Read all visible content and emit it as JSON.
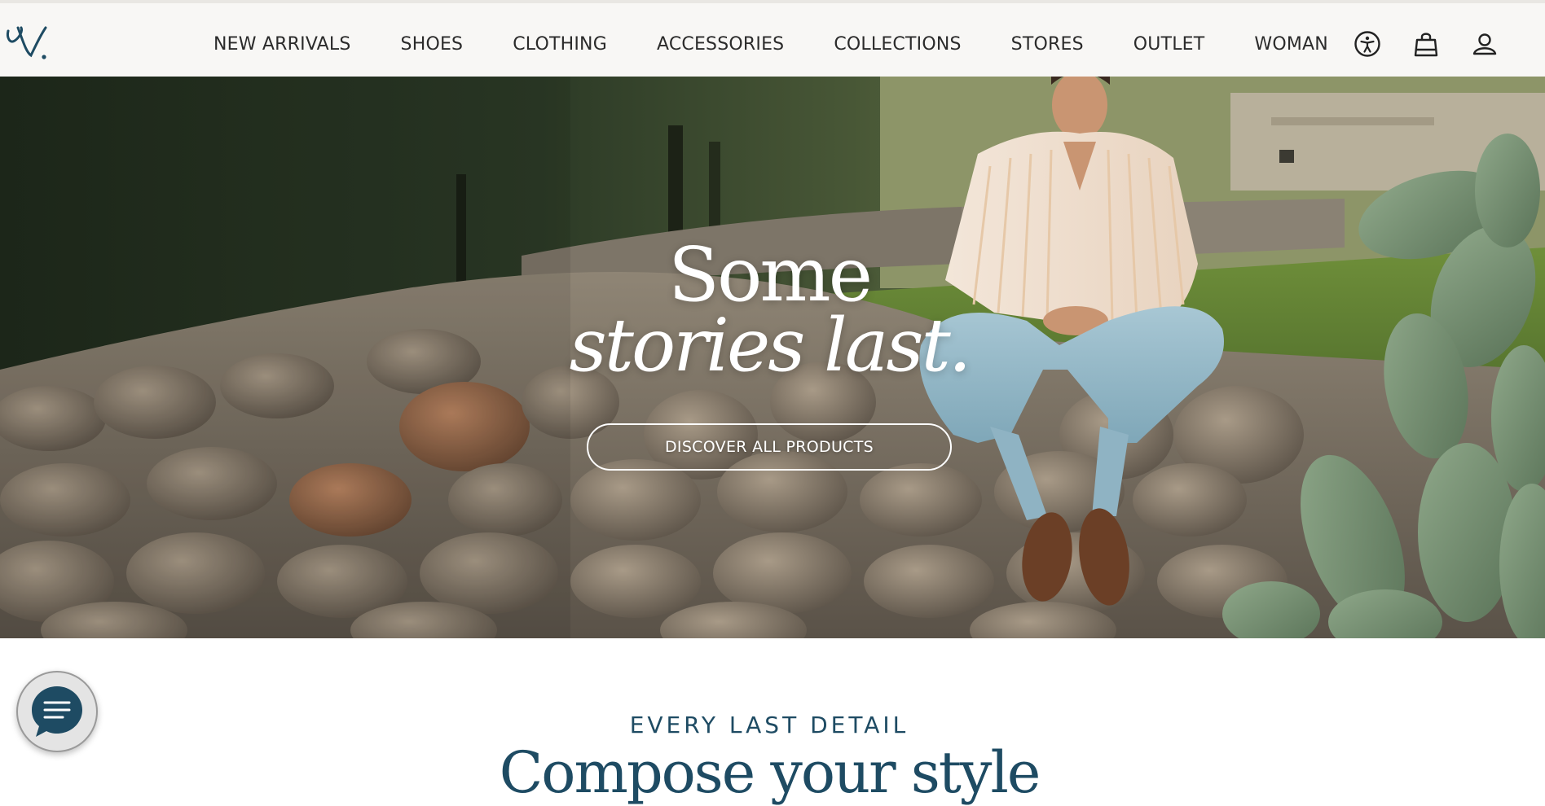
{
  "header": {
    "logo_text": "V.",
    "nav": [
      {
        "label": "NEW ARRIVALS"
      },
      {
        "label": "SHOES"
      },
      {
        "label": "CLOTHING"
      },
      {
        "label": "ACCESSORIES"
      },
      {
        "label": "COLLECTIONS"
      },
      {
        "label": "STORES"
      },
      {
        "label": "OUTLET"
      },
      {
        "label": "WOMAN"
      }
    ],
    "icons": [
      "accessibility-icon",
      "shopping-bag-icon",
      "user-account-icon"
    ]
  },
  "hero": {
    "title_line1": "Some",
    "title_line2": "stories last.",
    "cta_label": "DISCOVER ALL PRODUCTS"
  },
  "section": {
    "eyebrow": "EVERY LAST DETAIL",
    "title": "Compose your style"
  },
  "chat": {
    "icon": "chat-icon"
  },
  "colors": {
    "brand_blue": "#1e4b63",
    "header_bg": "#f8f7f5",
    "text_dark": "#2b2b2b"
  }
}
